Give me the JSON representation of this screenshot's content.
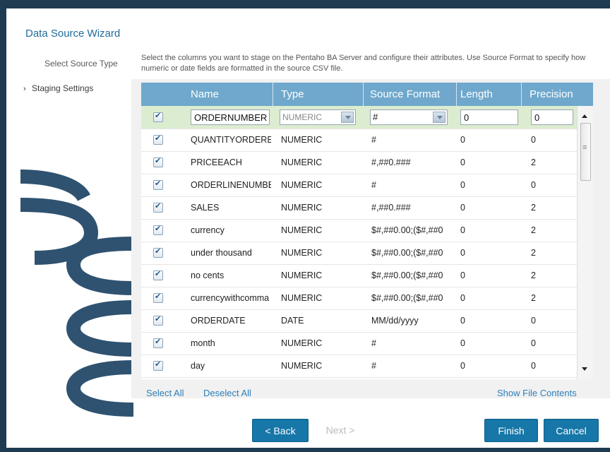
{
  "wizard": {
    "title": "Data Source Wizard"
  },
  "steps": [
    {
      "label": "Select Source Type"
    },
    {
      "label": "Staging Settings",
      "marker": "›"
    }
  ],
  "instructions": "Select the columns you want to stage on the Pentaho BA Server and configure their attributes. Use Source Format to specify how numeric or date fields are formatted in the source CSV file.",
  "grid": {
    "headers": {
      "name": "Name",
      "type": "Type",
      "source_format": "Source Format",
      "length": "Length",
      "precision": "Precision"
    },
    "rows": [
      {
        "checked": true,
        "name": "ORDERNUMBER",
        "type": "NUMERIC",
        "format": "#",
        "length": "0",
        "precision": "0"
      },
      {
        "checked": true,
        "name": "QUANTITYORDERED",
        "type": "NUMERIC",
        "format": "#",
        "length": "0",
        "precision": "0"
      },
      {
        "checked": true,
        "name": "PRICEEACH",
        "type": "NUMERIC",
        "format": "#,##0.###",
        "length": "0",
        "precision": "2"
      },
      {
        "checked": true,
        "name": "ORDERLINENUMBER",
        "type": "NUMERIC",
        "format": "#",
        "length": "0",
        "precision": "0"
      },
      {
        "checked": true,
        "name": "SALES",
        "type": "NUMERIC",
        "format": "#,##0.###",
        "length": "0",
        "precision": "2"
      },
      {
        "checked": true,
        "name": "currency",
        "type": "NUMERIC",
        "format": "$#,##0.00;($#,##0",
        "length": "0",
        "precision": "2"
      },
      {
        "checked": true,
        "name": "under thousand",
        "type": "NUMERIC",
        "format": "$#,##0.00;($#,##0",
        "length": "0",
        "precision": "2"
      },
      {
        "checked": true,
        "name": "no cents",
        "type": "NUMERIC",
        "format": "$#,##0.00;($#,##0",
        "length": "0",
        "precision": "2"
      },
      {
        "checked": true,
        "name": "currencywithcomma",
        "type": "NUMERIC",
        "format": "$#,##0.00;($#,##0",
        "length": "0",
        "precision": "2"
      },
      {
        "checked": true,
        "name": "ORDERDATE",
        "type": "DATE",
        "format": "MM/dd/yyyy",
        "length": "0",
        "precision": "0"
      },
      {
        "checked": true,
        "name": "month",
        "type": "NUMERIC",
        "format": "#",
        "length": "0",
        "precision": "0"
      },
      {
        "checked": true,
        "name": "day",
        "type": "NUMERIC",
        "format": "#",
        "length": "0",
        "precision": "0"
      }
    ]
  },
  "links": {
    "select_all": "Select All",
    "deselect_all": "Deselect All",
    "show_file_contents": "Show File Contents"
  },
  "buttons": {
    "back": "< Back",
    "next": "Next >",
    "finish": "Finish",
    "cancel": "Cancel"
  },
  "colors": {
    "header": "#6fa8cc",
    "primary": "#1677a8",
    "accent_link": "#2c7fb8",
    "selected_row": "#dcecd0",
    "frame": "#1e3b52"
  }
}
